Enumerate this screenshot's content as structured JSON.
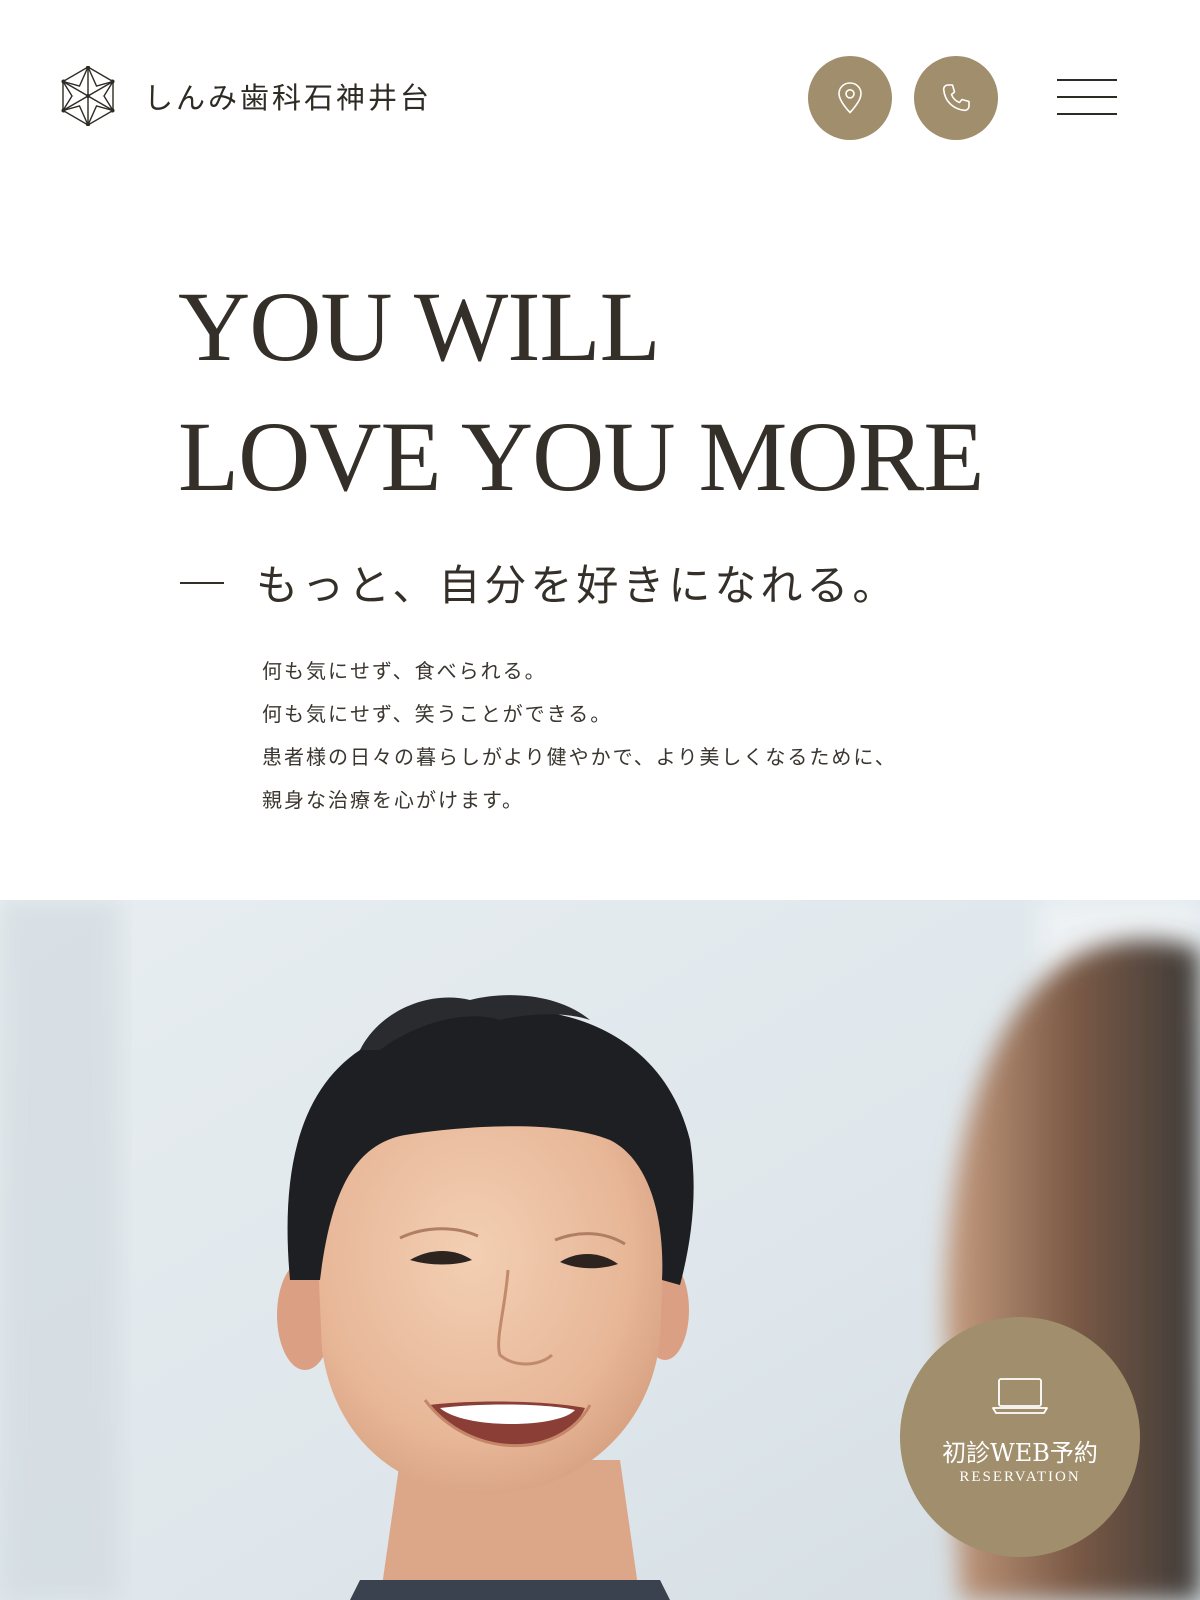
{
  "header": {
    "logo_text": "しんみ歯科石神井台",
    "map_icon": "map-pin-icon",
    "phone_icon": "phone-icon",
    "menu_icon": "hamburger-menu-icon"
  },
  "hero": {
    "title_line1": "YOU WILL",
    "title_line2": "LOVE YOU MORE",
    "subtitle": "もっと、自分を好きになれる。",
    "body": [
      "何も気にせず、食べられる。",
      "何も気にせず、笑うことができる。",
      "患者様の日々の暮らしがより健やかで、より美しくなるために、",
      "親身な治療を心がけます。"
    ]
  },
  "reservation": {
    "icon": "laptop-icon",
    "label": "初診WEB予約",
    "sub": "RESERVATION"
  },
  "colors": {
    "accent": "#a08e6c",
    "text": "#342f28",
    "background": "#ffffff"
  }
}
